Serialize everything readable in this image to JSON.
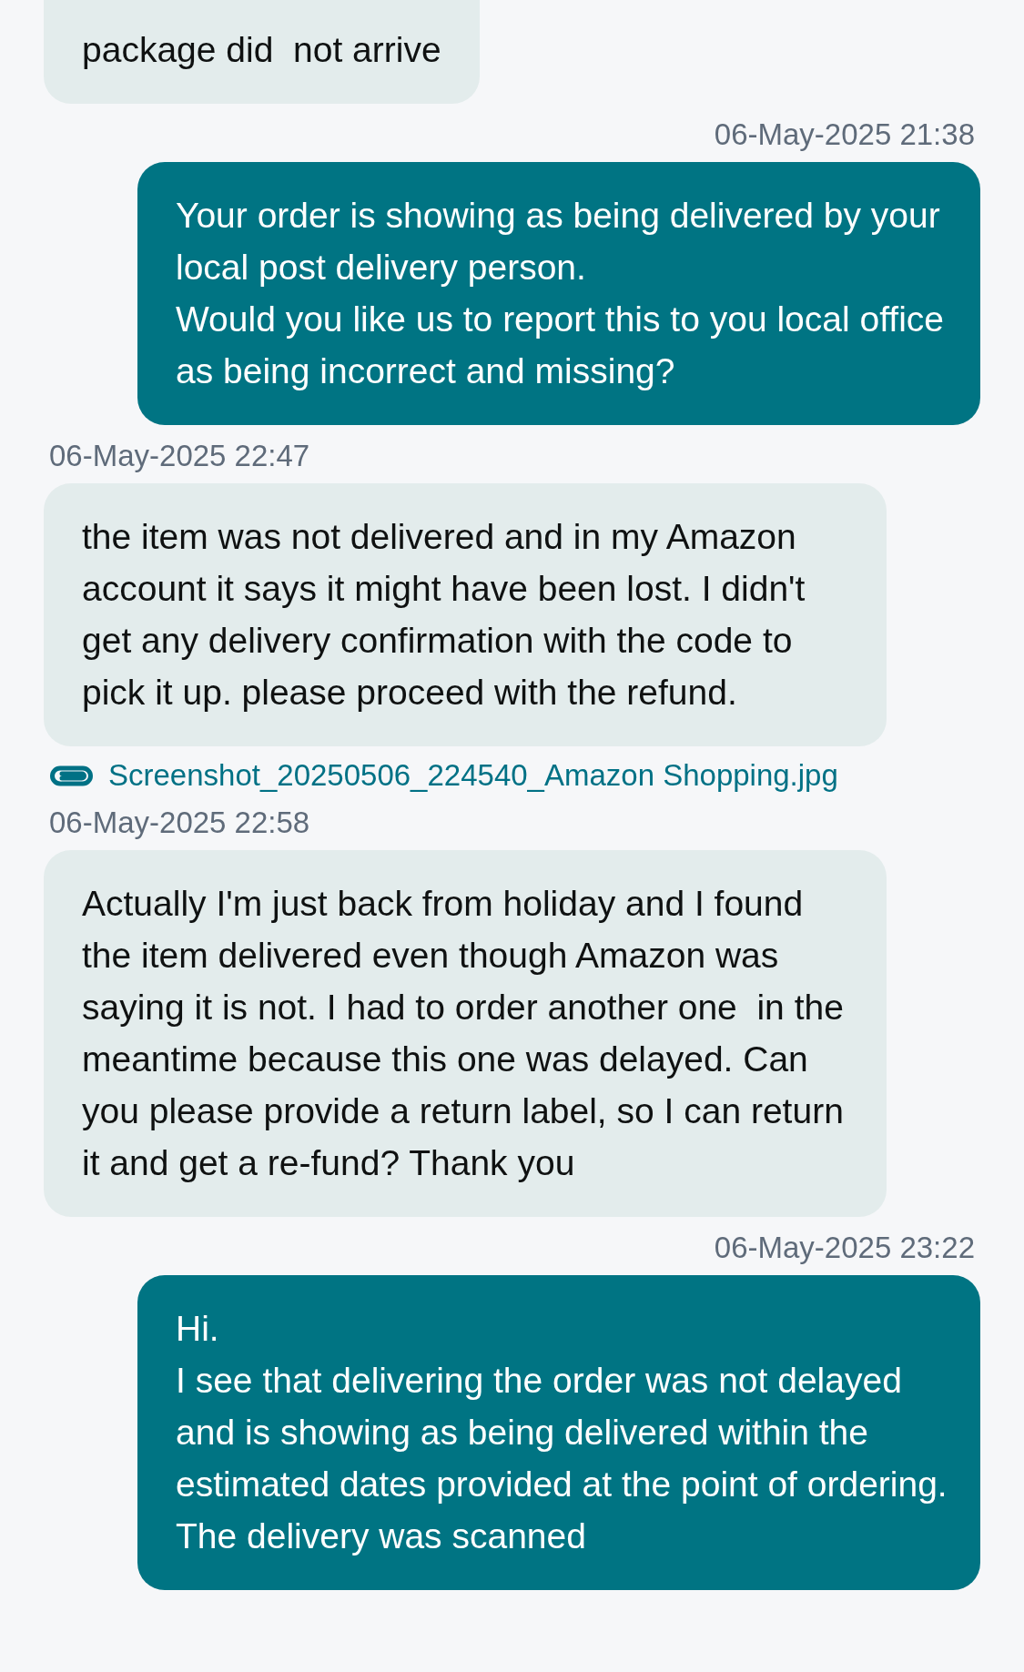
{
  "conversation": [
    {
      "kind": "message",
      "outgoing": false,
      "text": "package did  not arrive"
    },
    {
      "kind": "timestamp",
      "outgoing": true,
      "text": "06-May-2025 21:38"
    },
    {
      "kind": "message",
      "outgoing": true,
      "text": "Your order is showing as being delivered by your local post delivery person.\nWould you like us to report this to you local office as being incorrect and missing?"
    },
    {
      "kind": "timestamp",
      "outgoing": false,
      "text": "06-May-2025 22:47"
    },
    {
      "kind": "message",
      "outgoing": false,
      "text": "the item was not delivered and in my Amazon account it says it might have been lost. I didn't get any delivery confirmation with the code to pick it up. please proceed with the refund."
    },
    {
      "kind": "attachment",
      "outgoing": false,
      "text": "Screenshot_20250506_224540_Amazon Shopping.jpg"
    },
    {
      "kind": "timestamp",
      "outgoing": false,
      "text": "06-May-2025 22:58"
    },
    {
      "kind": "message",
      "outgoing": false,
      "text": "Actually I'm just back from holiday and I found the item delivered even though Amazon was saying it is not. I had to order another one  in the meantime because this one was delayed. Can you please provide a return label, so I can return it and get a re-fund? Thank you"
    },
    {
      "kind": "timestamp",
      "outgoing": true,
      "text": "06-May-2025 23:22"
    },
    {
      "kind": "message",
      "outgoing": true,
      "text": "Hi.\nI see that delivering the order was not delayed and is showing as being delivered within the estimated dates provided at the point of ordering. The delivery was scanned"
    }
  ]
}
